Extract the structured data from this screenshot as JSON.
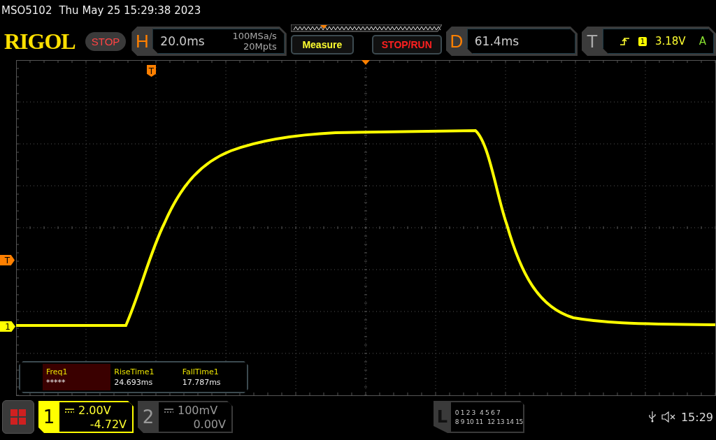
{
  "status_line": {
    "model": "MSO5102",
    "datetime": "Thu May 25 15:29:38 2023"
  },
  "header": {
    "logo": "RIGOL",
    "run_state": "STOP",
    "horizontal": {
      "label": "H",
      "timebase": "20.0ms",
      "sample_rate": "100MSa/s",
      "memory_depth": "20Mpts"
    },
    "buttons": [
      {
        "label": "Measure",
        "kind": "menu"
      },
      {
        "label": "STOP/RUN",
        "kind": "run"
      }
    ],
    "delay": {
      "label": "D",
      "value": "61.4ms"
    },
    "trigger": {
      "label": "T",
      "source": "1",
      "level": "3.18V",
      "mode": "A"
    }
  },
  "markers": [
    {
      "kind": "trigger-position",
      "label": "T"
    },
    {
      "kind": "trigger-level",
      "label": "T"
    },
    {
      "kind": "channel",
      "label": "1"
    }
  ],
  "measurements": [
    {
      "name": "Freq1",
      "value": "*****",
      "selected": true
    },
    {
      "name": "RiseTime1",
      "value": "24.693ms",
      "selected": false
    },
    {
      "name": "FallTime1",
      "value": "17.787ms",
      "selected": false
    }
  ],
  "channels": [
    {
      "number": "1",
      "scale": "2.00V",
      "offset": "-4.72V",
      "selected": true
    },
    {
      "number": "2",
      "scale": "100mV",
      "offset": "0.00V",
      "selected": false
    }
  ],
  "logic": {
    "label": "L",
    "rows": [
      [
        "0 1 2 3",
        "4 5 6 7"
      ],
      [
        "8 9 10 11",
        "12 13 14 15"
      ]
    ]
  },
  "status": {
    "time": "15:29"
  }
}
